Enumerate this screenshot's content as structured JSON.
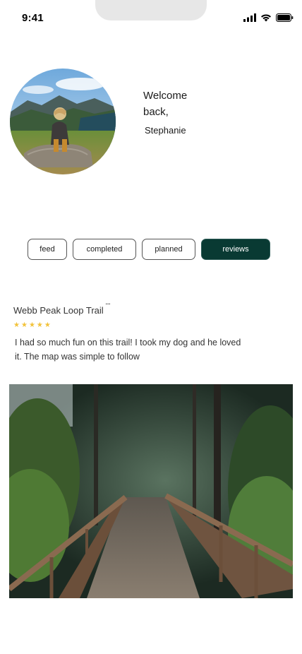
{
  "status_bar": {
    "time": "9:41"
  },
  "profile": {
    "welcome": "Welcome back,",
    "name": "Stephanie"
  },
  "tabs": [
    {
      "label": "feed",
      "active": false
    },
    {
      "label": "completed",
      "active": false
    },
    {
      "label": "planned",
      "active": false
    },
    {
      "label": "reviews",
      "active": true
    }
  ],
  "review": {
    "trail_name": "Webb Peak Loop Trail",
    "more_label": "...",
    "rating": 5,
    "text": "I had so much fun on this trail! I took my dog and he loved it. The map was simple to follow"
  },
  "icons": {
    "signal": "signal-icon",
    "wifi": "wifi-icon",
    "battery": "battery-icon",
    "star": "star-icon",
    "more": "more-icon"
  },
  "colors": {
    "accent": "#093a33",
    "star": "#f2c23a"
  }
}
